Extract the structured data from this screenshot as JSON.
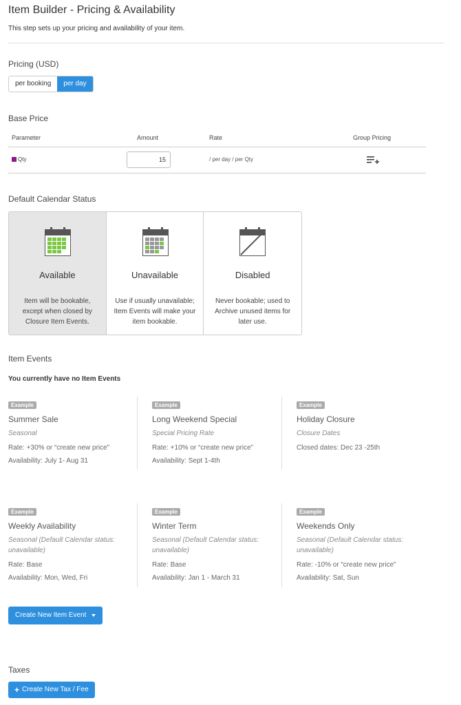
{
  "header": {
    "title": "Item Builder - Pricing & Availability",
    "subtitle": "This step sets up your pricing and availability of your item."
  },
  "pricing": {
    "title": "Pricing (USD)",
    "options": [
      "per booking",
      "per day"
    ],
    "selected": "per day"
  },
  "base_price": {
    "title": "Base Price",
    "columns": {
      "parameter": "Parameter",
      "amount": "Amount",
      "rate": "Rate",
      "group_pricing": "Group Pricing"
    },
    "row": {
      "parameter": "Qty",
      "parameter_color": "#8a1a8a",
      "amount": "15",
      "rate": "/ per day / per Qty"
    }
  },
  "calendar_status": {
    "title": "Default Calendar Status",
    "selected": "Available",
    "cards": [
      {
        "title": "Available",
        "desc": "Item will be bookable, except when closed by Closure Item Events."
      },
      {
        "title": "Unavailable",
        "desc": "Use if usually unavailable; Item Events will make your item bookable."
      },
      {
        "title": "Disabled",
        "desc": "Never bookable; used to Archive unused items for later use."
      }
    ]
  },
  "item_events": {
    "title": "Item Events",
    "empty_text": "You currently have no Item Events",
    "badge": "Example",
    "examples": [
      {
        "title": "Summer Sale",
        "type": "Seasonal",
        "rate": "Rate: +30% or “create new price”",
        "availability": "Availability: July 1- Aug 31"
      },
      {
        "title": "Long Weekend Special",
        "type": "Special Pricing Rate",
        "rate": "Rate: +10% or “create new price”",
        "availability": "Availability: Sept 1-4th"
      },
      {
        "title": "Holiday Closure",
        "type": "Closure Dates",
        "rate": "Closed dates: Dec 23 -25th",
        "availability": ""
      },
      {
        "title": "Weekly Availability",
        "type": "Seasonal (Default Calendar status: unavailable)",
        "rate": "Rate: Base",
        "availability": "Availability: Mon, Wed, Fri"
      },
      {
        "title": "Winter Term",
        "type": "Seasonal (Default Calendar status: unavailable)",
        "rate": "Rate: Base",
        "availability": "Availability: Jan 1 - March 31"
      },
      {
        "title": "Weekends Only",
        "type": "Seasonal (Default Calendar status: unavailable)",
        "rate": "Rate: -10% or “create new price”",
        "availability": "Availability: Sat, Sun"
      }
    ],
    "create_button": "Create New Item Event"
  },
  "taxes": {
    "title": "Taxes",
    "create_button": "Create New Tax / Fee"
  },
  "colors": {
    "accent": "#2d8fde",
    "calendar_green": "#7ac943",
    "calendar_dark": "#555555"
  }
}
